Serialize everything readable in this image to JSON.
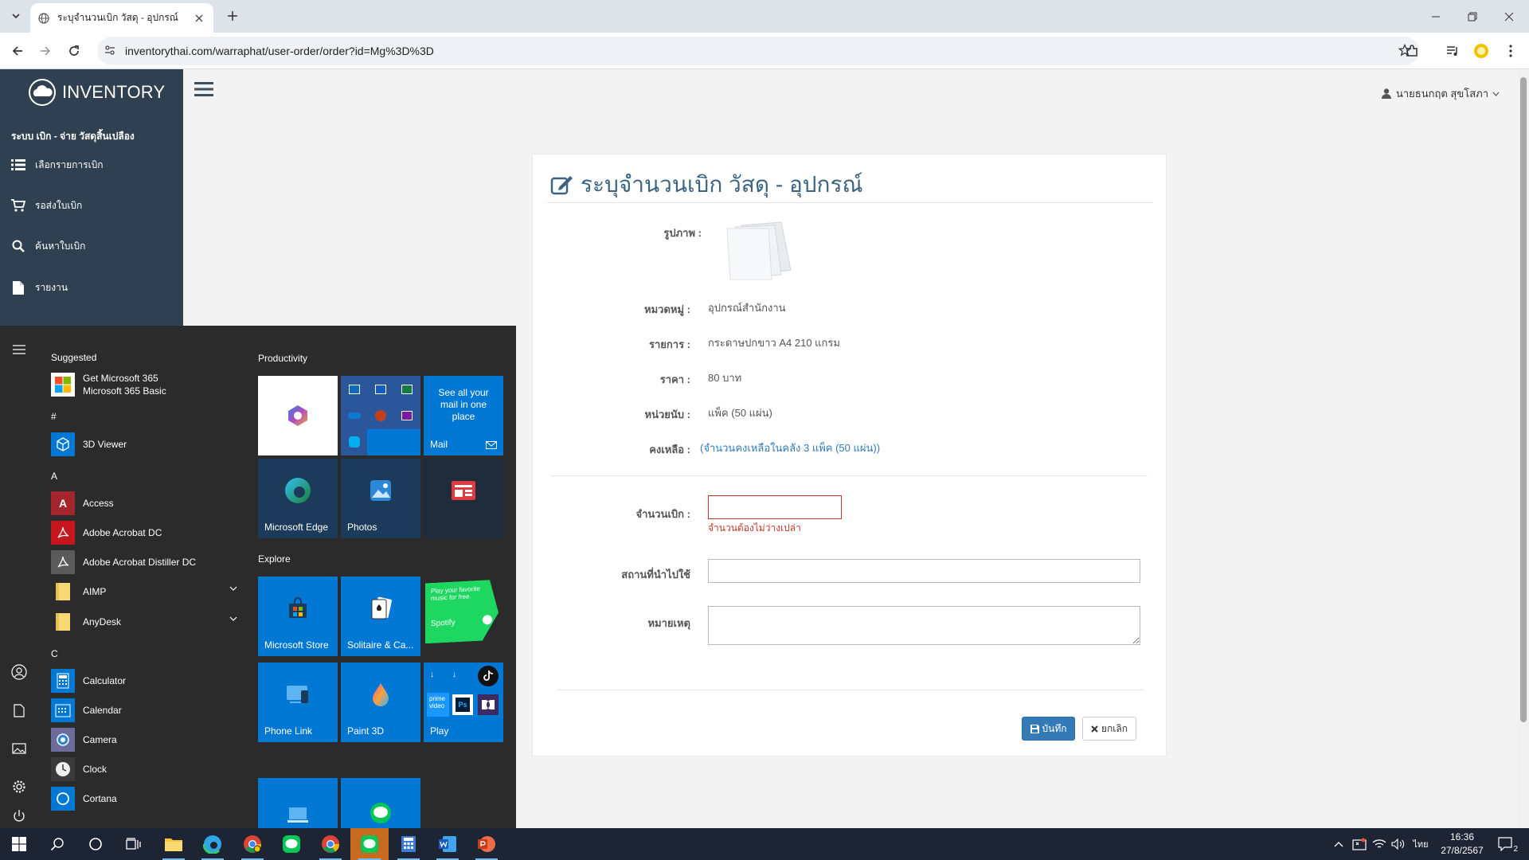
{
  "browser": {
    "tab_title": "ระบุจำนวนเบิก วัสดุ - อุปกรณ์",
    "url": "inventorythai.com/warraphat/user-order/order?id=Mg%3D%3D"
  },
  "app": {
    "logo_text": "INVENTORY",
    "menu_title": "ระบบ เบิก - จ่าย วัสดุสิ้นเปลือง",
    "menu_items": [
      {
        "label": "เลือกรายการเบิก",
        "icon": "list-icon"
      },
      {
        "label": "รอส่งใบเบิก",
        "icon": "cart-icon"
      },
      {
        "label": "ค้นหาใบเบิก",
        "icon": "search-icon"
      },
      {
        "label": "รายงาน",
        "icon": "file-icon"
      }
    ],
    "user_name": "นายธนกฤต สุขโสภา"
  },
  "form": {
    "title": "ระบุจำนวนเบิก วัสดุ - อุปกรณ์",
    "image_label": "รูปภาพ :",
    "category_label": "หมวดหมู่ :",
    "category_value": "อุปกรณ์สำนักงาน",
    "item_label": "รายการ :",
    "item_value": "กระดาษปกขาว A4 210 แกรม",
    "price_label": "ราคา :",
    "price_value": "80 บาท",
    "unit_label": "หน่วยนับ :",
    "unit_value": "แพ็ค (50 แผ่น)",
    "remaining_label": "คงเหลือ :",
    "remaining_value": "(จำนวนคงเหลือในคลัง 3 แพ็ค (50 แผ่น))",
    "quantity_label": "จำนวนเบิก :",
    "quantity_value": "",
    "quantity_error": "จำนวนต้องไม่ว่างเปล่า",
    "location_label": "สถานที่นำไปใช้",
    "location_value": "",
    "note_label": "หมายเหตุ",
    "note_value": "",
    "save_label": "บันทึก",
    "cancel_label": "ยกเลิก"
  },
  "start_menu": {
    "suggested_header": "Suggested",
    "suggested": [
      {
        "line1": "Get Microsoft 365",
        "line2": "Microsoft 365 Basic"
      }
    ],
    "letters": [
      "#",
      "A",
      "C"
    ],
    "apps": [
      {
        "name": "3D Viewer"
      },
      {
        "name": "Access"
      },
      {
        "name": "Adobe Acrobat DC"
      },
      {
        "name": "Adobe Acrobat Distiller DC"
      },
      {
        "name": "AIMP"
      },
      {
        "name": "AnyDesk"
      },
      {
        "name": "Calculator"
      },
      {
        "name": "Calendar"
      },
      {
        "name": "Camera"
      },
      {
        "name": "Clock"
      },
      {
        "name": "Cortana"
      }
    ],
    "groups": [
      "Productivity",
      "Explore"
    ],
    "tiles": {
      "mail_promo": "See all your mail in one place",
      "mail": "Mail",
      "edge": "Microsoft Edge",
      "photos": "Photos",
      "store": "Microsoft Store",
      "solitaire": "Solitaire & Ca...",
      "spotify_promo": "Play your favorite music for free.",
      "spotify": "Spotify",
      "phone_link": "Phone Link",
      "paint3d": "Paint 3D",
      "play": "Play",
      "prime": "prime video"
    }
  },
  "taskbar": {
    "lang": "ไทย",
    "time": "16:36",
    "date": "27/8/2567",
    "notifications": "2"
  }
}
